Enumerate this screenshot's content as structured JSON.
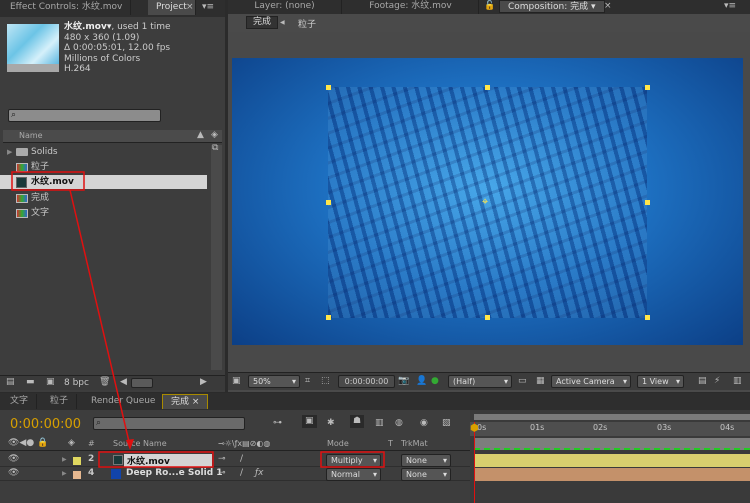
{
  "project_panel": {
    "tabs": [
      "Effect Controls: 水纹.mov",
      "Project"
    ],
    "info": {
      "name": "水纹.mov▾",
      "used": ", used 1 time",
      "dimensions": "480 x 360 (1.09)",
      "duration": "Δ 0:00:05:01, 12.00 fps",
      "colors": "Millions of Colors",
      "codec": "H.264"
    },
    "search_placeholder": "",
    "column_name": "Name",
    "items": [
      {
        "label": "Solids",
        "type": "folder"
      },
      {
        "label": "粒子",
        "type": "comp"
      },
      {
        "label": "水纹.mov",
        "type": "footage",
        "selected": true
      },
      {
        "label": "完成",
        "type": "comp"
      },
      {
        "label": "文字",
        "type": "comp"
      }
    ],
    "bpc": "8 bpc"
  },
  "comp_panel": {
    "tabs": [
      "Layer: (none)",
      "Footage: 水纹.mov",
      "Composition: 完成"
    ],
    "breadcrumb": [
      "完成",
      "粒子"
    ],
    "toolbar": {
      "zoom": "50%",
      "timecode": "0:00:00:00",
      "resolution": "(Half)",
      "camera": "Active Camera",
      "view": "1 View"
    }
  },
  "timeline": {
    "tabs": [
      "文字",
      "粒子",
      "Render Queue",
      "完成"
    ],
    "timecode": "0:00:00:00",
    "columns": {
      "hash": "#",
      "source_name": "Source Name",
      "mode": "Mode",
      "t": "T",
      "trkmat": "TrkMat"
    },
    "ruler": [
      "0s",
      "01s",
      "02s",
      "03s",
      "04s"
    ],
    "layers": [
      {
        "index": "2",
        "name": "水纹.mov",
        "label_color": "#e0d860",
        "mode": "Multiply",
        "trkmat": "None",
        "bar_color": "#d8cf6e"
      },
      {
        "index": "4",
        "name": "Deep Ro...e Solid 1",
        "label_color": "#e6b890",
        "mode": "Normal",
        "trkmat": "None",
        "bar_color": "#c4916a"
      }
    ]
  },
  "colors": {
    "accent_timecode": "#d8a000",
    "annotation_red": "#e01010",
    "comp_blue": "#1d6fc0"
  }
}
